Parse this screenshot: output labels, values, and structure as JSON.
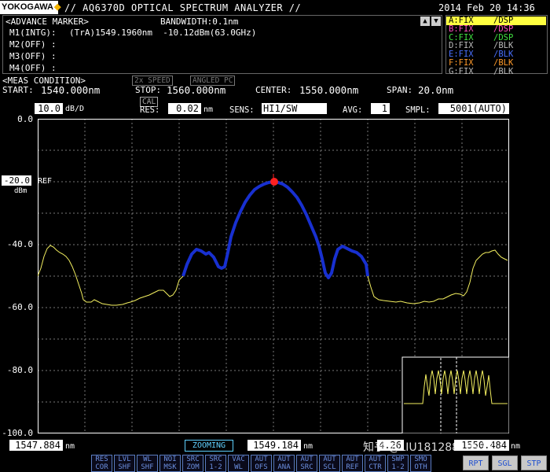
{
  "title_bar": {
    "brand": "YOKOGAWA",
    "app_title": "// AQ6370D OPTICAL SPECTRUM ANALYZER //",
    "datetime": "2014 Feb 20 14:36"
  },
  "marker_panel": {
    "header": "<ADVANCE MARKER>",
    "bandwidth": "BANDWIDTH:0.1nm",
    "rows": [
      {
        "label": "M1(INTG):",
        "value": "(TrA)1549.1960nm  -10.12dBm(63.0GHz)"
      },
      {
        "label": "M2(OFF) :",
        "value": ""
      },
      {
        "label": "M3(OFF) :",
        "value": ""
      },
      {
        "label": "M4(OFF) :",
        "value": ""
      }
    ],
    "scroll_up": "▲",
    "scroll_down": "▼"
  },
  "traces": [
    {
      "name": "A:FIX",
      "state": "/DSP",
      "color": "#ffff40",
      "selected": true
    },
    {
      "name": "B:FIX",
      "state": "/DSP",
      "color": "#ff4fbf",
      "selected": false
    },
    {
      "name": "C:FIX",
      "state": "/DSP",
      "color": "#40e040",
      "selected": false
    },
    {
      "name": "D:FIX",
      "state": "/BLK",
      "color": "#bbbbbb",
      "selected": false
    },
    {
      "name": "E:FIX",
      "state": "/BLK",
      "color": "#4a70ff",
      "selected": false
    },
    {
      "name": "F:FIX",
      "state": "/BLK",
      "color": "#ff9a2a",
      "selected": false
    },
    {
      "name": "G:FIX",
      "state": "/BLK",
      "color": "#bbbbbb",
      "selected": false
    }
  ],
  "meas": {
    "header": "<MEAS CONDITION>",
    "speed": "2x SPEED",
    "angled": "ANGLED PC",
    "start_label": "START:",
    "start": "1540.000nm",
    "stop_label": "STOP:",
    "stop": "1560.000nm",
    "center_label": "CENTER:",
    "center": "1550.000nm",
    "span_label": "SPAN:",
    "span": "20.0nm"
  },
  "settings": {
    "scale": "10.0",
    "scale_unit": "dB/D",
    "cal": "CAL",
    "res_label": "RES:",
    "res": "0.02",
    "res_unit": "nm",
    "sens_label": "SENS:",
    "sens": "HI1/SW",
    "avg_label": "AVG:",
    "avg": "1",
    "smpl_label": "SMPL:",
    "smpl": "5001(AUTO)"
  },
  "y_axis": {
    "ticks": [
      "0.0",
      "-20.0",
      "-40.0",
      "-60.0",
      "-80.0",
      "-100.0"
    ],
    "ref_value": "-20.0",
    "ref_label": "REF",
    "unit": "dBm"
  },
  "bottom_bar": {
    "left_wl": "1547.884",
    "left_unit": "nm",
    "zoom_label": "ZOOMING",
    "center_wl": "1549.184",
    "center_unit": "nm",
    "span_label": "4.26",
    "right_wl": "1550.484",
    "right_unit": "nm",
    "watermark": "知乎 @LIU18128810938"
  },
  "softkeys": [
    "RES\nCOR",
    "LVL\nSHF",
    "WL\nSHF",
    "NOI\nMSK",
    "SRC\nZOM",
    "SRC\n1-2",
    "VAC\nWL",
    "AUT\nOFS",
    "AUT\nANA",
    "AUT\nSRC",
    "AUT\nSCL",
    "AUT\nREF",
    "AUT\nCTR",
    "SWP\n1-2",
    "SMO\nOTH"
  ],
  "right_keys": [
    "RPT",
    "SGL",
    "STP"
  ],
  "colors": {
    "accent": "#ffff40",
    "trace_main": "#1830d0",
    "marker": "#ff2020",
    "grid": "#777777"
  }
}
